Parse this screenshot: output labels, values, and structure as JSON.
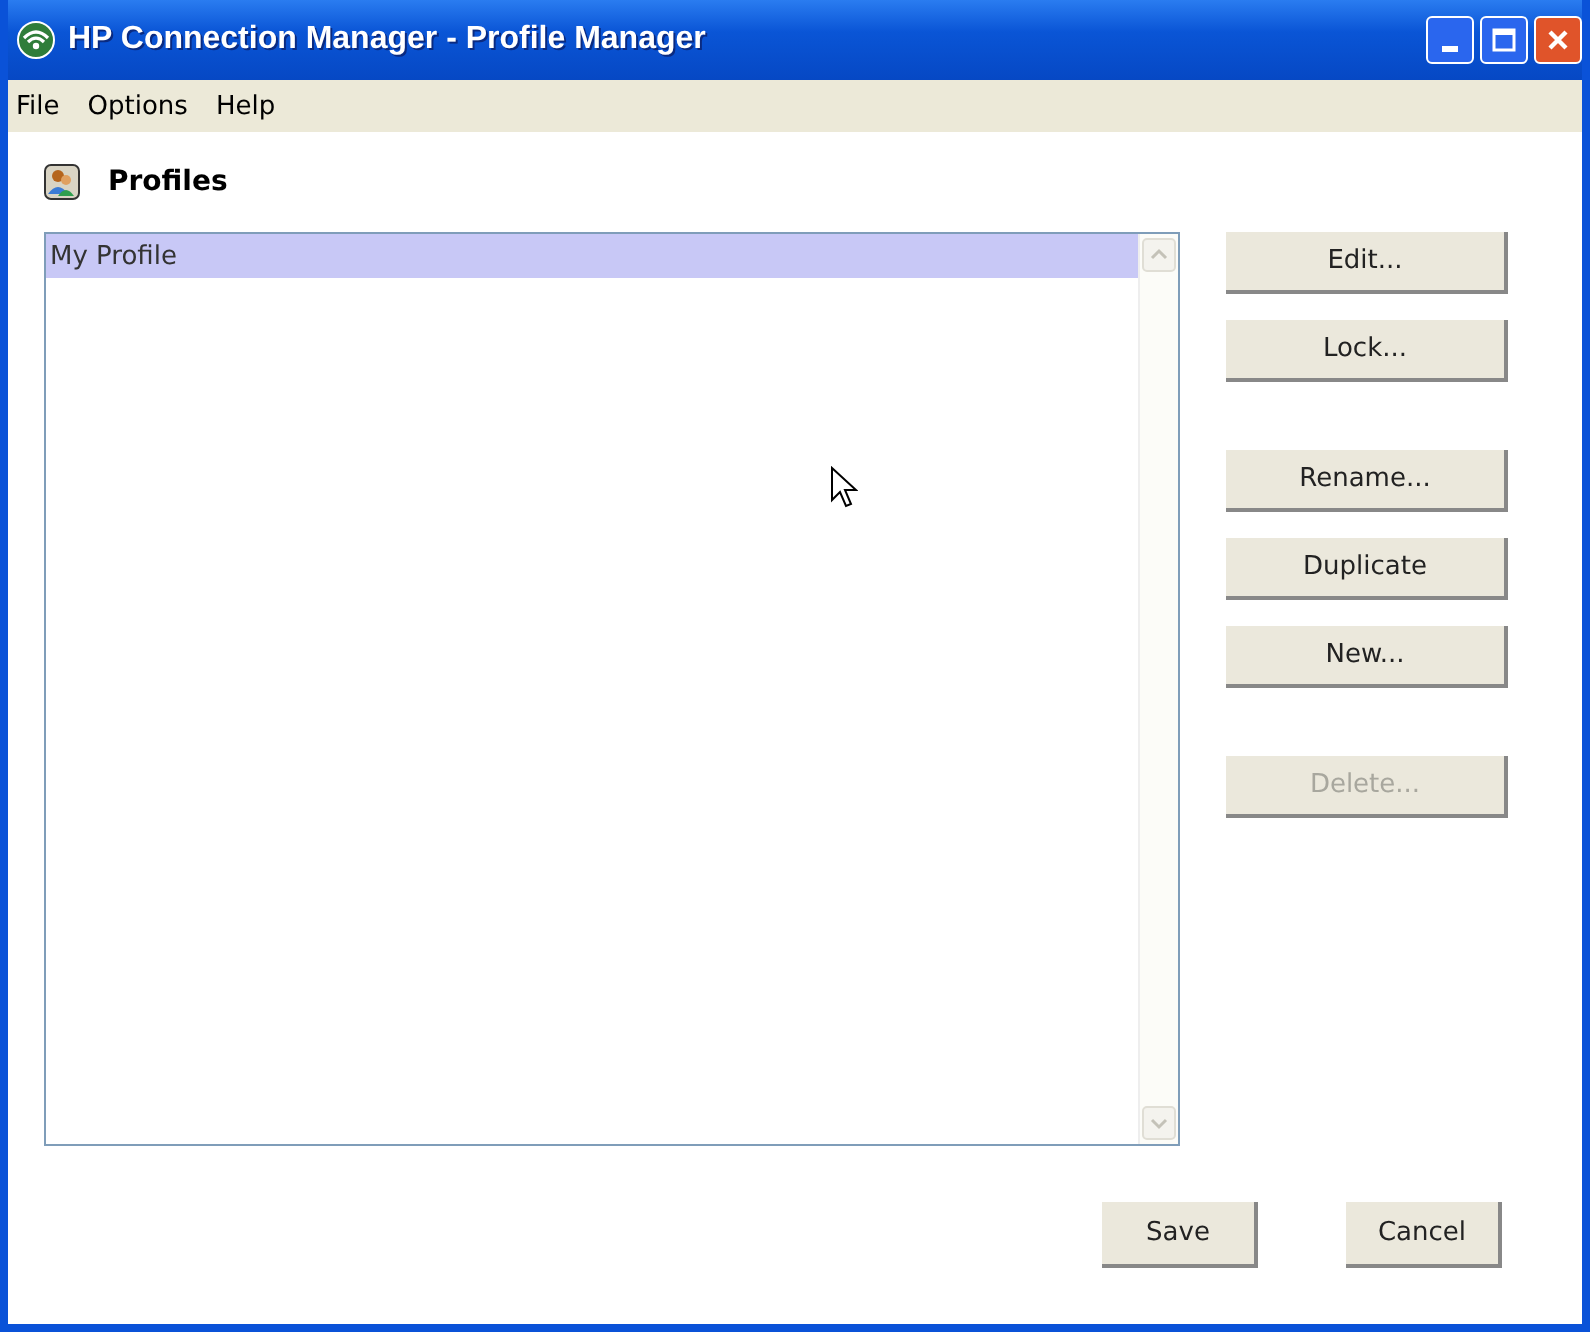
{
  "window": {
    "title": "HP Connection Manager - Profile Manager"
  },
  "menu": [
    "File",
    "Options",
    "Help"
  ],
  "section": {
    "title": "Profiles"
  },
  "profiles": [
    {
      "label": "My Profile",
      "selected": true
    }
  ],
  "button_groups": [
    [
      {
        "label": "Edit...",
        "disabled": false
      },
      {
        "label": "Lock...",
        "disabled": false
      }
    ],
    [
      {
        "label": "Rename...",
        "disabled": false
      },
      {
        "label": "Duplicate",
        "disabled": false
      },
      {
        "label": "New...",
        "disabled": false
      }
    ],
    [
      {
        "label": "Delete...",
        "disabled": true
      }
    ]
  ],
  "footer_buttons": [
    "Save",
    "Cancel"
  ]
}
